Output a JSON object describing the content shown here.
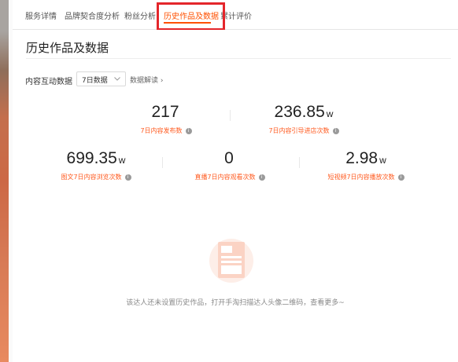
{
  "tabs": [
    {
      "label": "服务详情"
    },
    {
      "label": "品牌契合度分析"
    },
    {
      "label": "粉丝分析"
    },
    {
      "label": "历史作品及数据"
    },
    {
      "label": "累计评价"
    }
  ],
  "active_tab": 3,
  "section": {
    "title": "历史作品及数据",
    "filter_label": "内容互动数据",
    "period_select": "7日数据",
    "interpret_link": "数据解读 ›"
  },
  "metrics_row1": [
    {
      "value": "217",
      "unit": "",
      "label": "7日内容发布数"
    },
    {
      "value": "236.85",
      "unit": "w",
      "label": "7日内容引导进店次数"
    }
  ],
  "metrics_row2": [
    {
      "value": "699.35",
      "unit": "w",
      "label": "图文7日内容浏览次数"
    },
    {
      "value": "0",
      "unit": "",
      "label": "直播7日内容观看次数"
    },
    {
      "value": "2.98",
      "unit": "w",
      "label": "短视频7日内容播放次数"
    }
  ],
  "info_glyph": "i",
  "empty_state": {
    "message": "该达人还未设置历史作品，打开手淘扫描达人头像二维码，查看更多~"
  },
  "colors": {
    "accent": "#ff5000",
    "highlight_box": "#e4262b",
    "label": "#ff5a1f"
  }
}
